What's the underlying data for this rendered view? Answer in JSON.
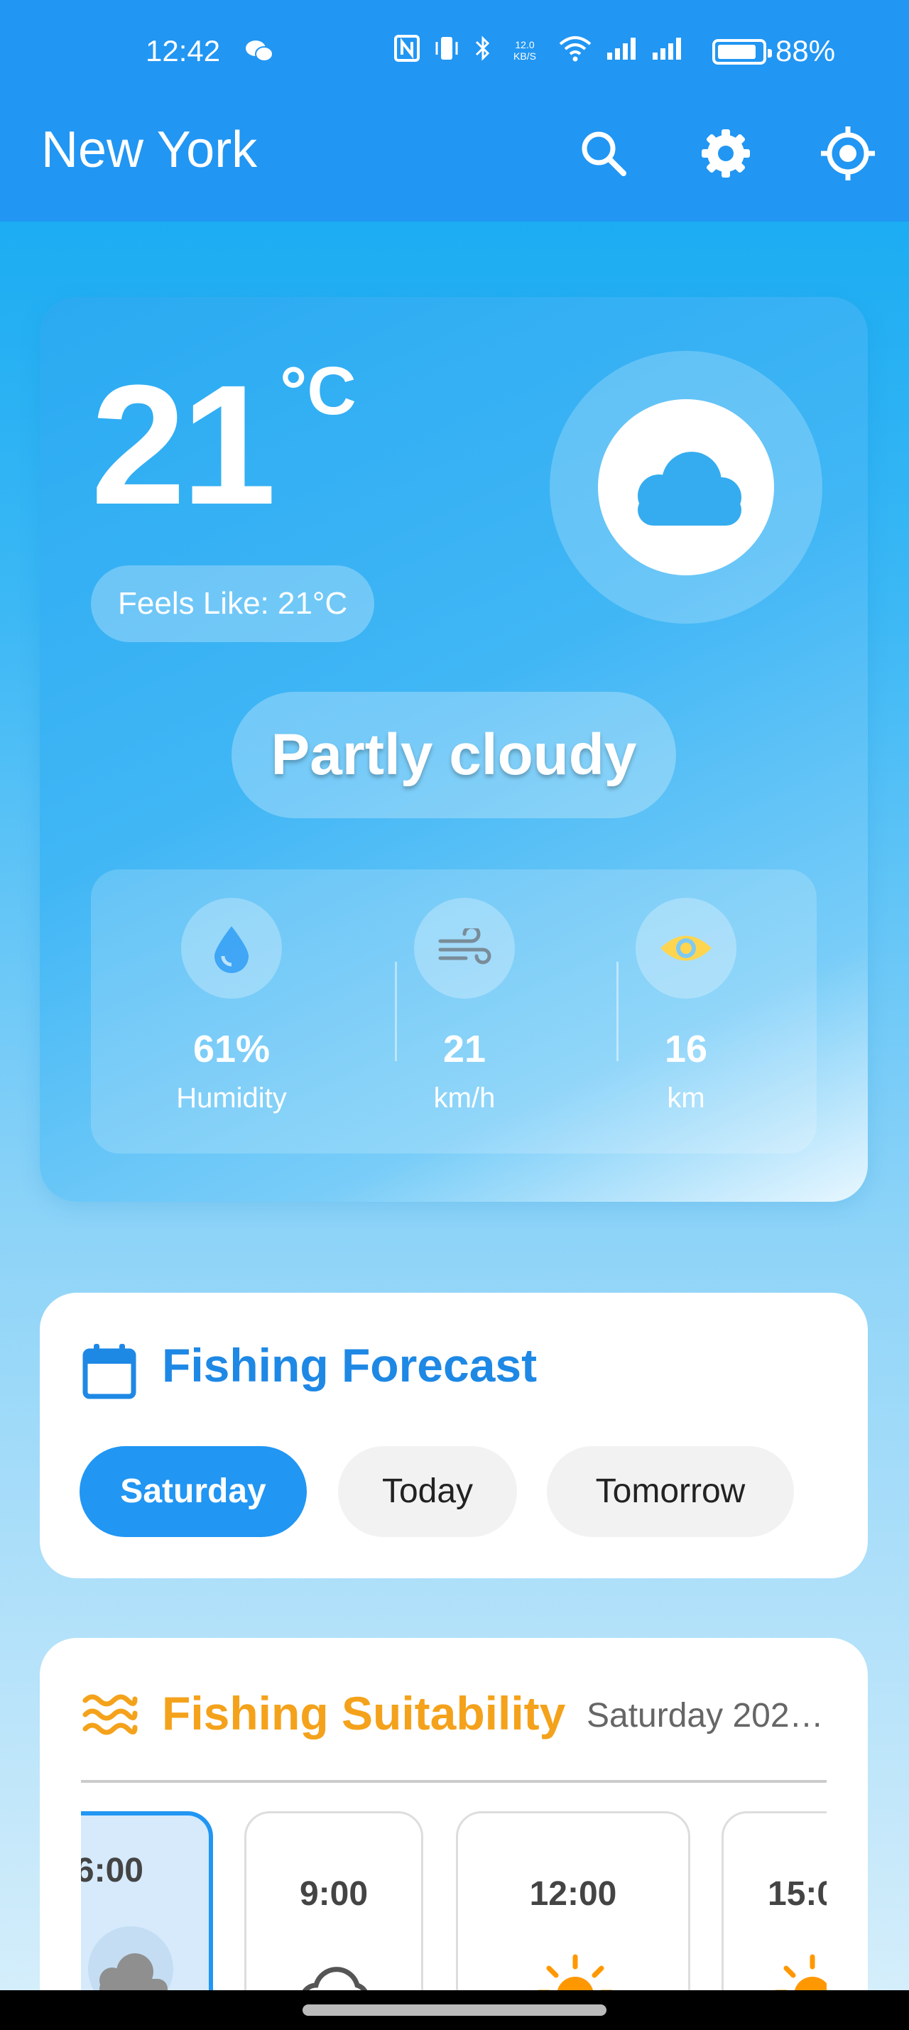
{
  "status_bar": {
    "time": "12:42",
    "battery_percent": "88%",
    "battery_level": 0.88,
    "net_speed": "12.0 KB/S",
    "icons": [
      "wechat-icon",
      "nfc-icon",
      "vibrate-icon",
      "bluetooth-icon",
      "wifi-icon",
      "signal-icon",
      "signal-icon",
      "battery-icon"
    ]
  },
  "app_bar": {
    "title": "New York",
    "icons": [
      "search-icon",
      "settings-gear-icon",
      "my-location-icon"
    ]
  },
  "weather": {
    "temperature": "21",
    "unit": "°C",
    "feels_like": "Feels Like: 21°C",
    "condition": "Partly cloudy",
    "icon": "cloud-icon",
    "stats": [
      {
        "icon": "water-drop-icon",
        "value": "61%",
        "label": "Humidity"
      },
      {
        "icon": "wind-icon",
        "value": "21",
        "label": "km/h"
      },
      {
        "icon": "eye-icon",
        "value": "16",
        "label": "km"
      }
    ]
  },
  "fishing_forecast": {
    "title": "Fishing Forecast",
    "icon": "calendar-icon",
    "tabs": [
      {
        "label": "Saturday",
        "selected": true
      },
      {
        "label": "Today",
        "selected": false
      },
      {
        "label": "Tomorrow",
        "selected": false
      }
    ]
  },
  "fishing_suitability": {
    "title": "Fishing Suitability",
    "date": "Saturday 202…",
    "icon": "waves-icon",
    "hours": [
      {
        "time": "6:00",
        "icon": "cloud-icon",
        "selected": true
      },
      {
        "time": "9:00",
        "icon": "cloud-icon",
        "selected": false
      },
      {
        "time": "12:00",
        "icon": "sun-icon",
        "selected": false
      },
      {
        "time": "15:0",
        "icon": "sun-icon",
        "selected": false
      }
    ]
  },
  "colors": {
    "app_bar": "#2196f3",
    "accent_blue": "#1e88e5",
    "accent_orange": "#f4a21b",
    "sun": "#ff9800",
    "eye": "#ffd54f"
  }
}
